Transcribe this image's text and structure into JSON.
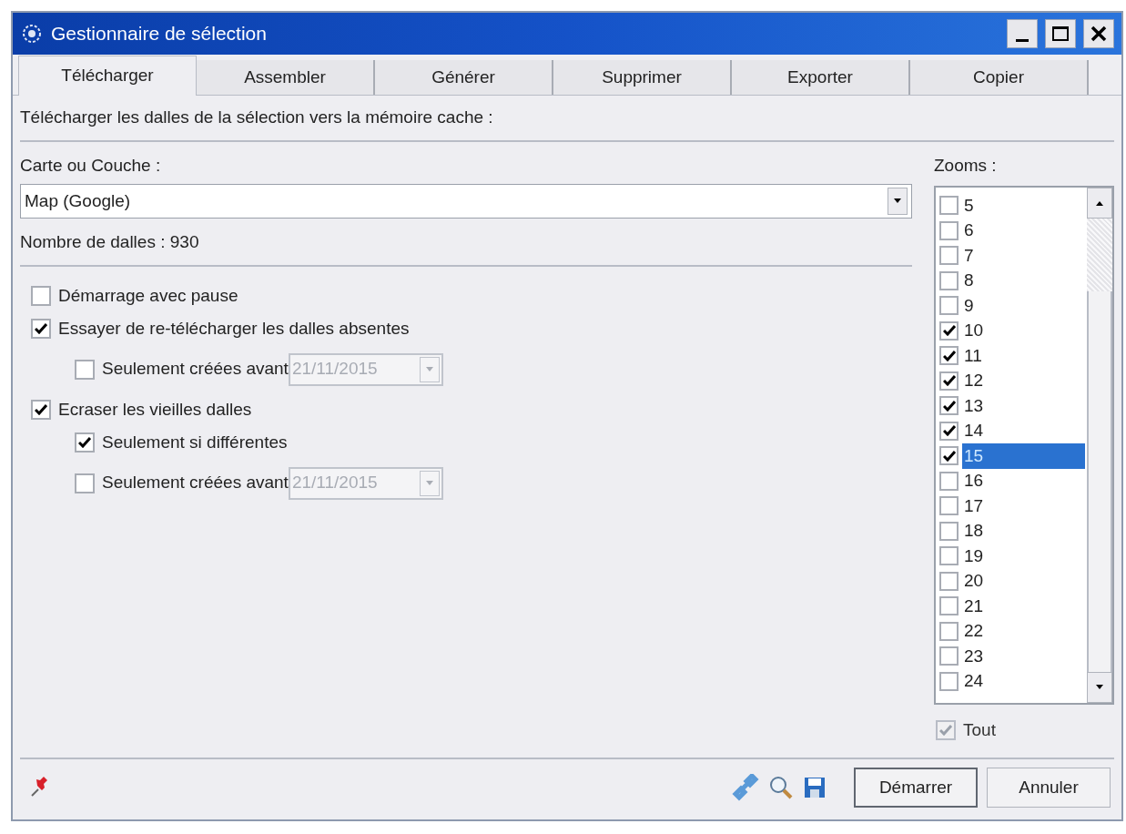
{
  "window": {
    "title": "Gestionnaire de sélection"
  },
  "tabs": [
    {
      "label": "Télécharger",
      "selected": true
    },
    {
      "label": "Assembler",
      "selected": false
    },
    {
      "label": "Générer",
      "selected": false
    },
    {
      "label": "Supprimer",
      "selected": false
    },
    {
      "label": "Exporter",
      "selected": false
    },
    {
      "label": "Copier",
      "selected": false
    }
  ],
  "description": "Télécharger les dalles de la sélection vers la mémoire cache :",
  "layer": {
    "label": "Carte ou Couche :",
    "value": "Map (Google)"
  },
  "tile_count": "Nombre de dalles : 930",
  "options": [
    {
      "kind": "checkbox",
      "label": "Démarrage avec pause",
      "checked": false
    },
    {
      "kind": "checkbox",
      "label": "Essayer de re-télécharger les dalles absentes",
      "checked": true,
      "children": [
        {
          "kind": "date_filter",
          "label": "Seulement créées avant",
          "checked": false,
          "date": "21/11/2015",
          "disabled": true
        }
      ]
    },
    {
      "kind": "checkbox",
      "label": "Ecraser les vieilles dalles",
      "checked": true,
      "children": [
        {
          "kind": "checkbox",
          "label": "Seulement si différentes",
          "checked": true
        },
        {
          "kind": "date_filter",
          "label": "Seulement créées avant",
          "checked": false,
          "date": "21/11/2015",
          "disabled": true
        }
      ]
    }
  ],
  "zooms": {
    "label": "Zooms :",
    "items": [
      {
        "label": "5",
        "checked": false,
        "selected": false
      },
      {
        "label": "6",
        "checked": false,
        "selected": false
      },
      {
        "label": "7",
        "checked": false,
        "selected": false
      },
      {
        "label": "8",
        "checked": false,
        "selected": false
      },
      {
        "label": "9",
        "checked": false,
        "selected": false
      },
      {
        "label": "10",
        "checked": true,
        "selected": false
      },
      {
        "label": "11",
        "checked": true,
        "selected": false
      },
      {
        "label": "12",
        "checked": true,
        "selected": false
      },
      {
        "label": "13",
        "checked": true,
        "selected": false
      },
      {
        "label": "14",
        "checked": true,
        "selected": false
      },
      {
        "label": "15",
        "checked": true,
        "selected": true
      },
      {
        "label": "16",
        "checked": false,
        "selected": false
      },
      {
        "label": "17",
        "checked": false,
        "selected": false
      },
      {
        "label": "18",
        "checked": false,
        "selected": false
      },
      {
        "label": "19",
        "checked": false,
        "selected": false
      },
      {
        "label": "20",
        "checked": false,
        "selected": false
      },
      {
        "label": "21",
        "checked": false,
        "selected": false
      },
      {
        "label": "22",
        "checked": false,
        "selected": false
      },
      {
        "label": "23",
        "checked": false,
        "selected": false
      },
      {
        "label": "24",
        "checked": false,
        "selected": false
      }
    ],
    "all": {
      "label": "Tout",
      "checked": true,
      "disabled": true
    }
  },
  "buttons": [
    {
      "label": "Démarrer",
      "default": true
    },
    {
      "label": "Annuler",
      "default": false
    }
  ]
}
